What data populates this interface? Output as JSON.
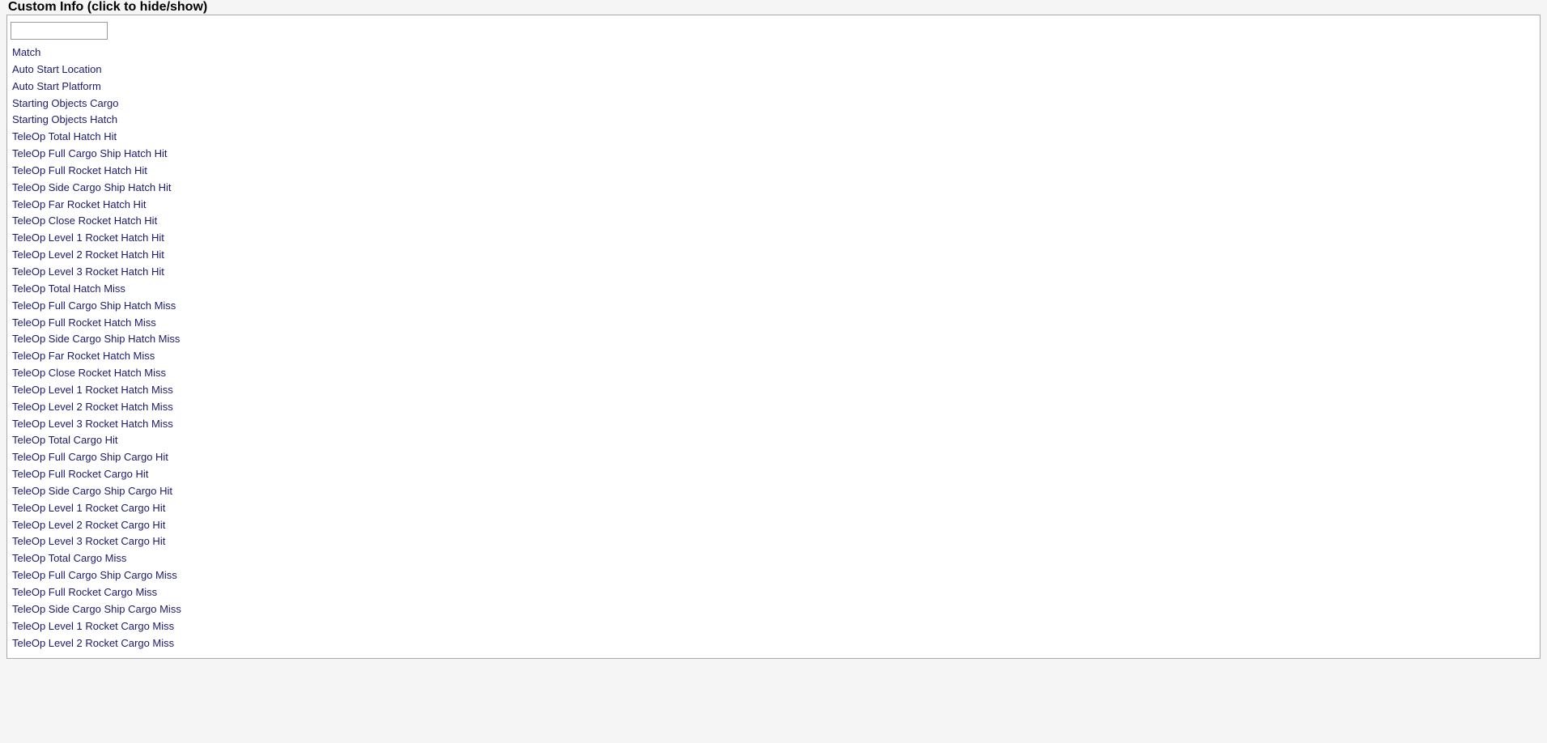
{
  "header": {
    "title": "Custom Info (click to hide/show)"
  },
  "search": {
    "value": "",
    "placeholder": ""
  },
  "items": [
    "Match",
    "Auto Start Location",
    "Auto Start Platform",
    "Starting Objects Cargo",
    "Starting Objects Hatch",
    "TeleOp Total Hatch Hit",
    "TeleOp Full Cargo Ship Hatch Hit",
    "TeleOp Full Rocket Hatch Hit",
    "TeleOp Side Cargo Ship Hatch Hit",
    "TeleOp Far Rocket Hatch Hit",
    "TeleOp Close Rocket Hatch Hit",
    "TeleOp Level 1 Rocket Hatch Hit",
    "TeleOp Level 2 Rocket Hatch Hit",
    "TeleOp Level 3 Rocket Hatch Hit",
    "TeleOp Total Hatch Miss",
    "TeleOp Full Cargo Ship Hatch Miss",
    "TeleOp Full Rocket Hatch Miss",
    "TeleOp Side Cargo Ship Hatch Miss",
    "TeleOp Far Rocket Hatch Miss",
    "TeleOp Close Rocket Hatch Miss",
    "TeleOp Level 1 Rocket Hatch Miss",
    "TeleOp Level 2 Rocket Hatch Miss",
    "TeleOp Level 3 Rocket Hatch Miss",
    "TeleOp Total Cargo Hit",
    "TeleOp Full Cargo Ship Cargo Hit",
    "TeleOp Full Rocket Cargo Hit",
    "TeleOp Side Cargo Ship Cargo Hit",
    "TeleOp Level 1 Rocket Cargo Hit",
    "TeleOp Level 2 Rocket Cargo Hit",
    "TeleOp Level 3 Rocket Cargo Hit",
    "TeleOp Total Cargo Miss",
    "TeleOp Full Cargo Ship Cargo Miss",
    "TeleOp Full Rocket Cargo Miss",
    "TeleOp Side Cargo Ship Cargo Miss",
    "TeleOp Level 1 Rocket Cargo Miss",
    "TeleOp Level 2 Rocket Cargo Miss"
  ]
}
